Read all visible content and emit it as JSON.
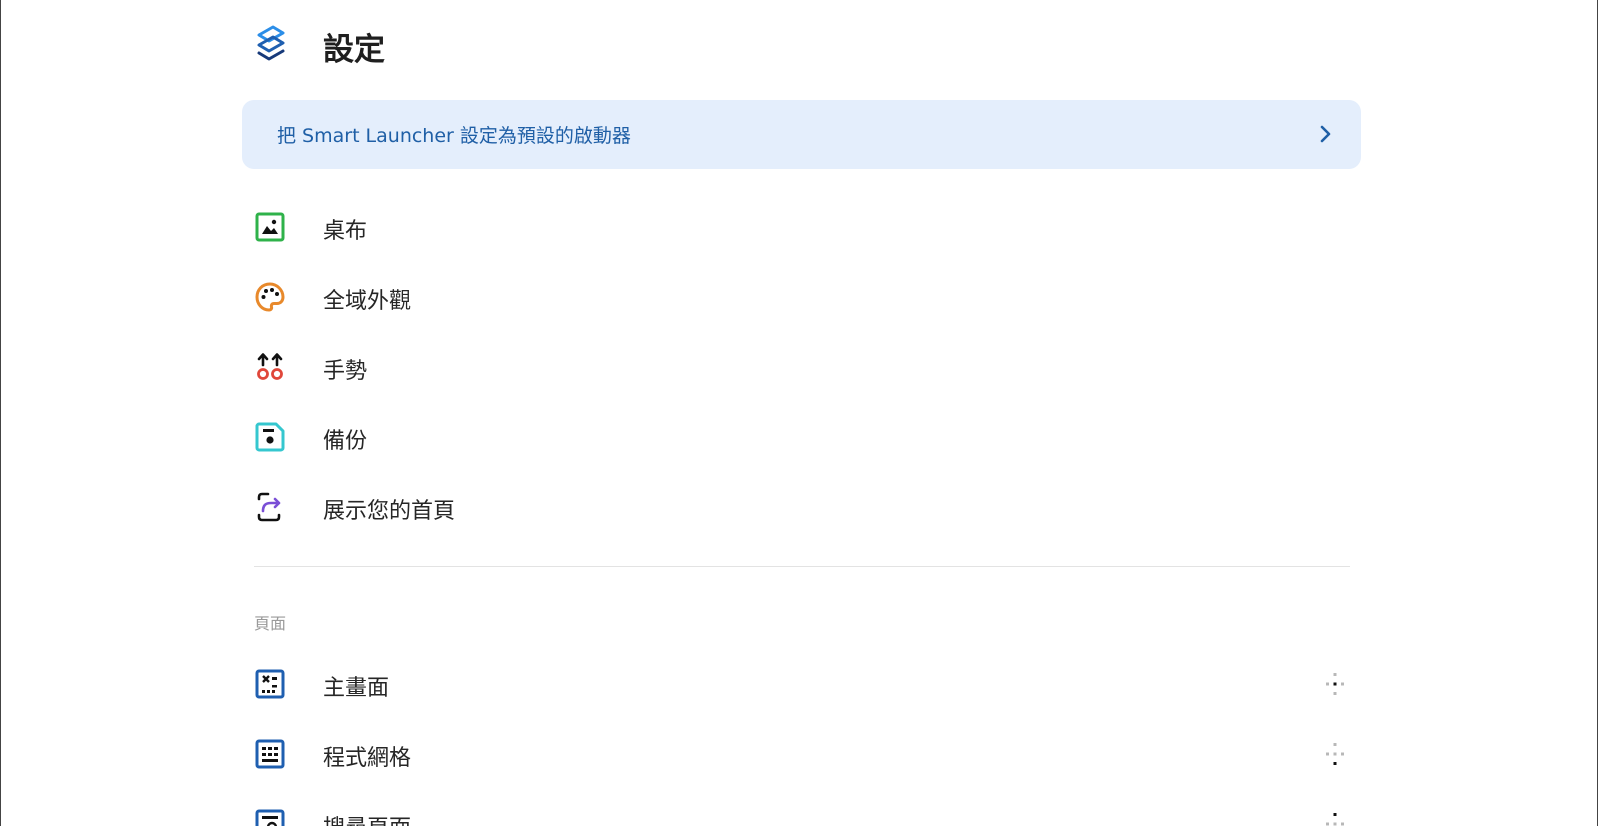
{
  "header": {
    "title": "設定",
    "logo_icon": "smart-launcher-logo-icon"
  },
  "banner": {
    "text": "把 Smart Launcher 設定為預設的啟動器",
    "chevron_icon": "chevron-right-icon",
    "background": "#e4eefc",
    "text_color": "#1f5fa6"
  },
  "menu": {
    "items": [
      {
        "label": "桌布",
        "icon": "wallpaper-icon",
        "color": "#2fb24a"
      },
      {
        "label": "全域外觀",
        "icon": "palette-icon",
        "color": "#e8892b"
      },
      {
        "label": "手勢",
        "icon": "gestures-icon",
        "color": "#e0473a"
      },
      {
        "label": "備份",
        "icon": "backup-icon",
        "color": "#35c7cf"
      },
      {
        "label": "展示您的首頁",
        "icon": "share-icon",
        "color": "#7a4fd6"
      }
    ]
  },
  "pages": {
    "section_label": "頁面",
    "items": [
      {
        "label": "主畫面",
        "icon": "home-screen-icon",
        "handle_icon": "drag-handle-icon"
      },
      {
        "label": "程式網格",
        "icon": "app-grid-icon",
        "handle_icon": "drag-handle-icon"
      },
      {
        "label": "搜尋頁面",
        "icon": "search-page-icon",
        "handle_icon": "drag-handle-icon"
      }
    ],
    "icon_color": "#1f5fb0"
  }
}
